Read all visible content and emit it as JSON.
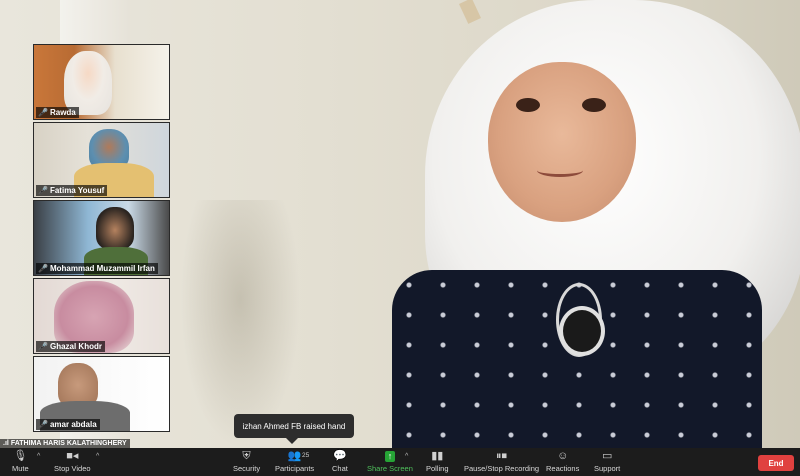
{
  "participants_gallery": [
    {
      "name": "Rawda"
    },
    {
      "name": "Fatima Yousuf"
    },
    {
      "name": "Mohammad Muzammil Irfan"
    },
    {
      "name": "Ghazal Khodr"
    },
    {
      "name": "amar abdala"
    }
  ],
  "self_view_label": "FATHIMA HARIS KALATHINGHERY",
  "notification": "izhan  Ahmed FB raised hand",
  "toolbar": {
    "mute": "Mute",
    "stop_video": "Stop Video",
    "security": "Security",
    "participants": "Participants",
    "participants_count": "25",
    "chat": "Chat",
    "share_screen": "Share Screen",
    "polling": "Polling",
    "recording": "Pause/Stop Recording",
    "reactions": "Reactions",
    "support": "Support",
    "end": "End"
  },
  "icons": {
    "mute": "microphone-icon",
    "video": "video-camera-icon",
    "security": "shield-icon",
    "participants": "people-icon",
    "chat": "chat-bubble-icon",
    "share": "share-arrow-icon",
    "polling": "bar-chart-icon",
    "recording": "pause-stop-icon",
    "reactions": "smiley-plus-icon",
    "support": "screen-support-icon"
  },
  "colors": {
    "toolbar_bg": "#1c1c1c",
    "share_green": "#26a336",
    "end_red": "#e0413f",
    "muted_mic_red": "#e23c3c"
  }
}
